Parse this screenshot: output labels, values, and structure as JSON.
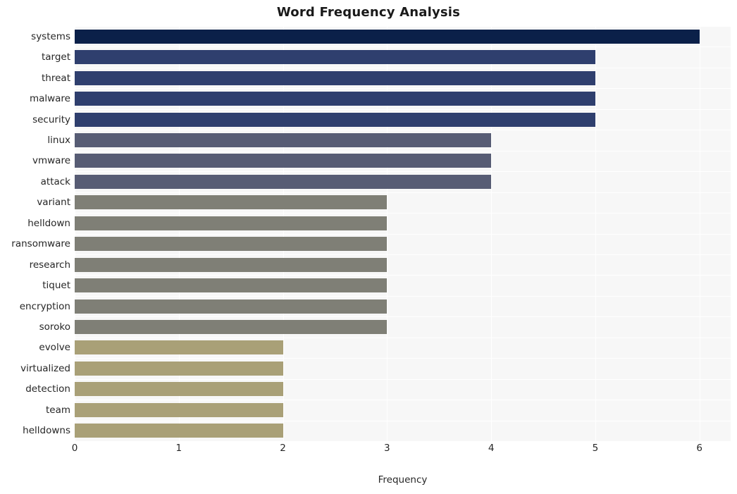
{
  "chart_data": {
    "type": "bar",
    "orientation": "horizontal",
    "title": "Word Frequency Analysis",
    "xlabel": "Frequency",
    "ylabel": "",
    "xlim": [
      0,
      6.3
    ],
    "xticks": [
      0,
      1,
      2,
      3,
      4,
      5,
      6
    ],
    "xtick_labels": [
      "0",
      "1",
      "2",
      "3",
      "4",
      "5",
      "6"
    ],
    "grid": true,
    "legend": false,
    "categories": [
      "systems",
      "target",
      "threat",
      "malware",
      "security",
      "linux",
      "vmware",
      "attack",
      "variant",
      "helldown",
      "ransomware",
      "research",
      "tiquet",
      "encryption",
      "soroko",
      "evolve",
      "virtualized",
      "detection",
      "team",
      "helldowns"
    ],
    "values": [
      6,
      5,
      5,
      5,
      5,
      4,
      4,
      4,
      3,
      3,
      3,
      3,
      3,
      3,
      3,
      2,
      2,
      2,
      2,
      2
    ],
    "bar_colors": [
      "#0b2049",
      "#2f3f6e",
      "#2f3f6e",
      "#2f3f6e",
      "#2f3f6e",
      "#575c74",
      "#575c74",
      "#575c74",
      "#7f7f76",
      "#7f7f76",
      "#7f7f76",
      "#7f7f76",
      "#7f7f76",
      "#7f7f76",
      "#7f7f76",
      "#a9a077",
      "#a9a077",
      "#a9a077",
      "#a9a077",
      "#a9a077"
    ],
    "plot_background": "#f7f7f7",
    "grid_color": "#ffffff",
    "text_color": "#262626"
  }
}
